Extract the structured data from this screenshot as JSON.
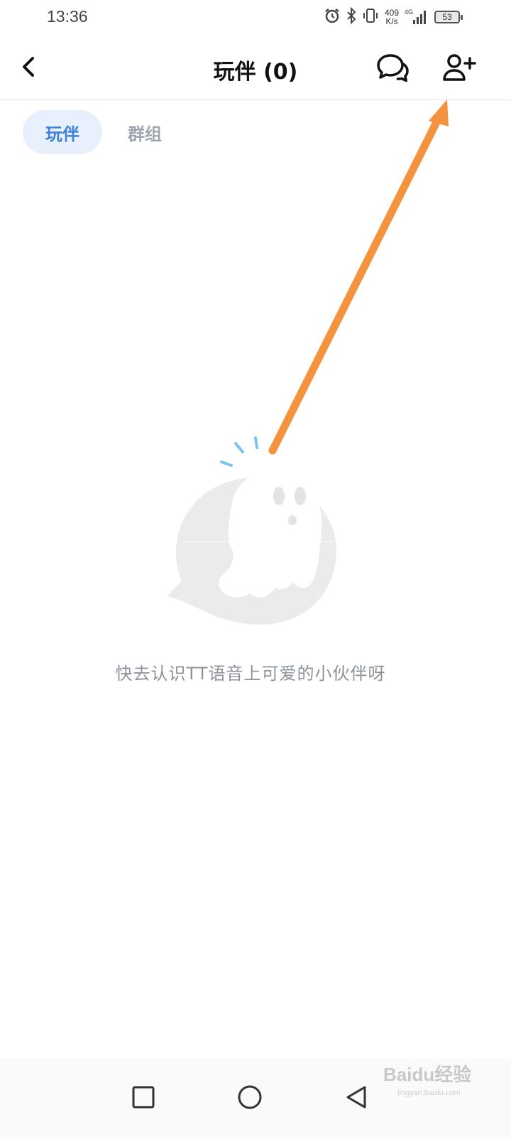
{
  "status_bar": {
    "time": "13:36",
    "net_speed_value": "409",
    "net_speed_unit": "K/s",
    "signal_label": "4G",
    "battery": "53",
    "icons": [
      "alarm-icon",
      "bluetooth-icon",
      "vibrate-icon",
      "signal-icon",
      "battery-icon"
    ]
  },
  "header": {
    "title": "玩伴 (0)",
    "icons": [
      "back-arrow-icon",
      "chat-bubbles-icon",
      "add-user-icon"
    ]
  },
  "tabs": [
    {
      "label": "玩伴",
      "active": true
    },
    {
      "label": "群组",
      "active": false
    }
  ],
  "empty_state": {
    "message": "快去认识TT语音上可爱的小伙伴呀",
    "illustration": "ghost-icon"
  },
  "annotation": {
    "color": "#f5923e"
  },
  "colors": {
    "accent": "#3b82d8",
    "tab_active_bg": "#e8f0fd",
    "muted_text": "#8e9399"
  },
  "nav_bar": {
    "icons": [
      "recent-apps-icon",
      "home-icon",
      "back-icon"
    ]
  },
  "watermark": {
    "brand": "Baidu经验",
    "url": "jingyan.baidu.com"
  }
}
